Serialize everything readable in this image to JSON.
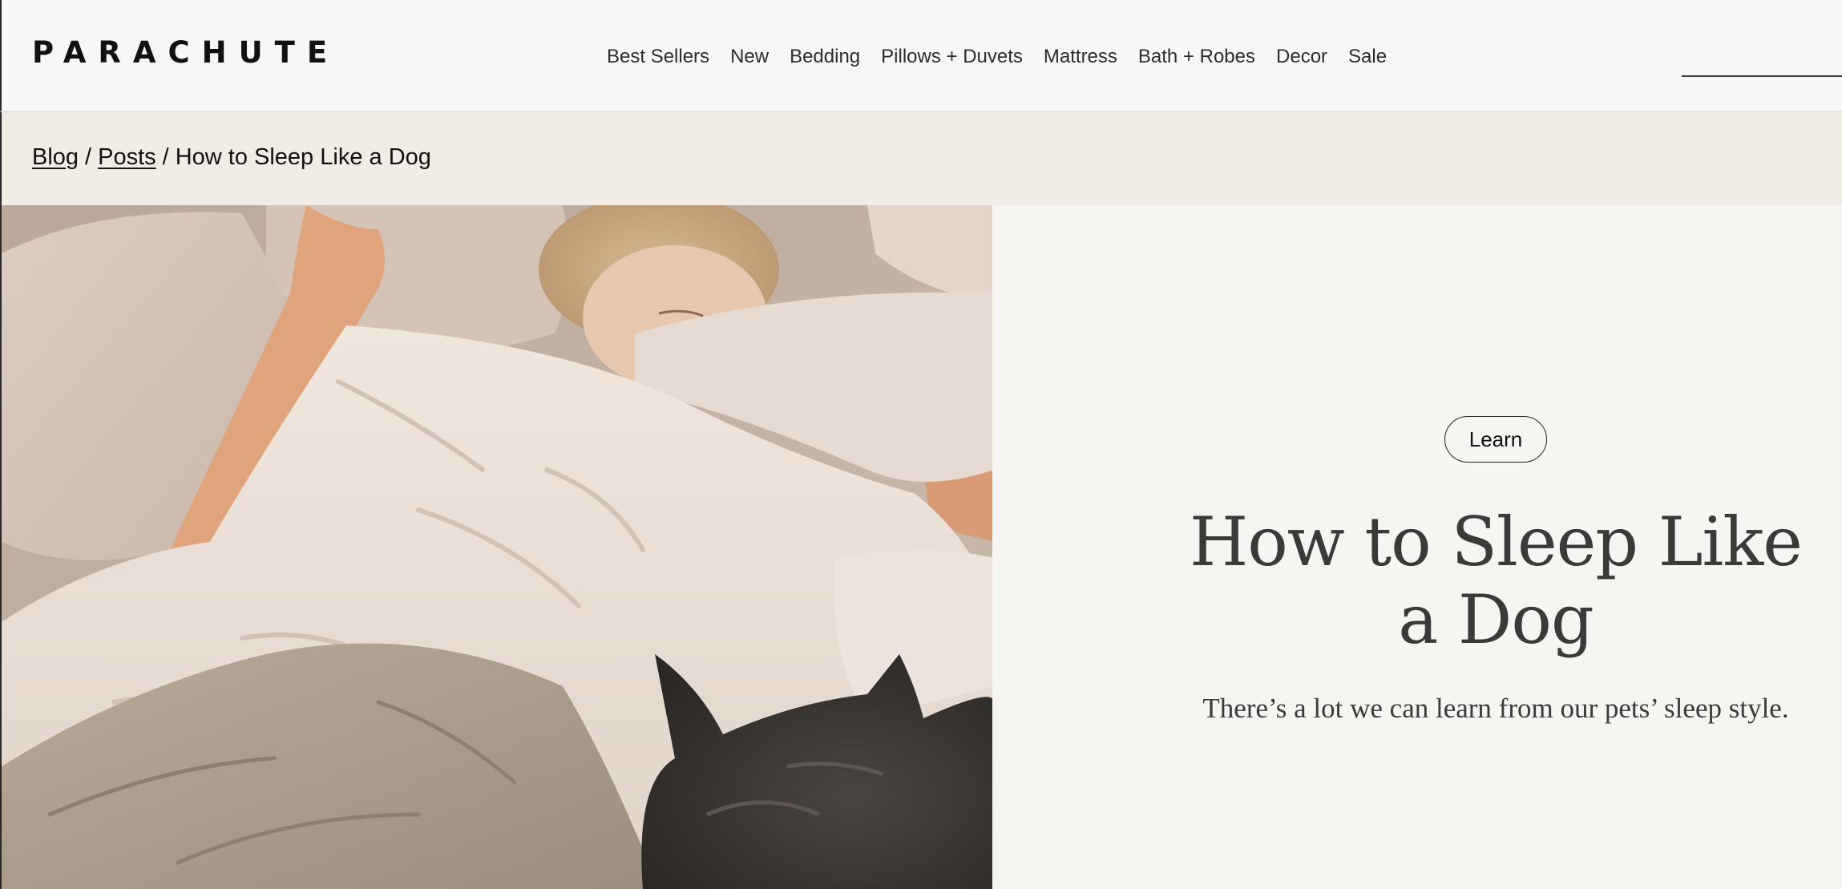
{
  "brand": {
    "logo": "PARACHUTE"
  },
  "nav": {
    "items": [
      "Best Sellers",
      "New",
      "Bedding",
      "Pillows + Duvets",
      "Mattress",
      "Bath + Robes",
      "Decor",
      "Sale"
    ]
  },
  "search": {
    "placeholder": "",
    "value": "",
    "icon": "search-icon"
  },
  "breadcrumb": {
    "items": [
      {
        "label": "Blog",
        "link": true
      },
      {
        "label": "Posts",
        "link": true
      },
      {
        "label": "How to Sleep Like a Dog",
        "link": false
      }
    ],
    "separator": "/"
  },
  "article": {
    "category": "Learn",
    "title": "How to Sleep Like a Dog",
    "subtitle": "There’s a lot we can learn from our pets’ sleep style."
  },
  "colors": {
    "header_bg": "#f7f7f7",
    "breadcrumb_bg": "#f1ece4",
    "panel_bg": "#f6f5f2",
    "title_text": "#3b3a38"
  }
}
